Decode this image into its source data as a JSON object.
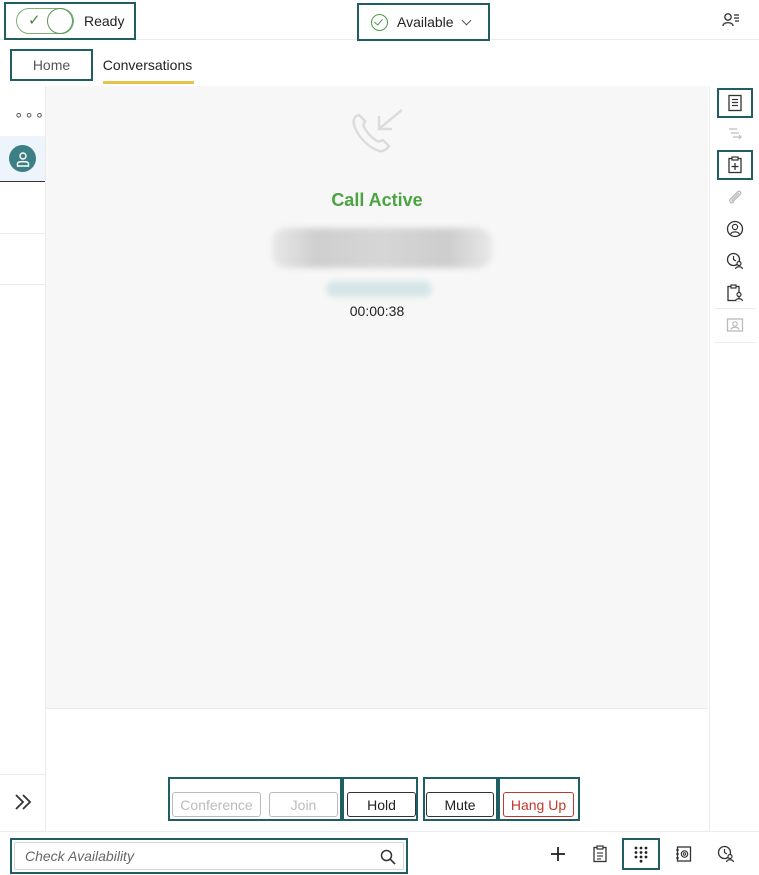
{
  "header": {
    "ready_label": "Ready",
    "availability_label": "Available"
  },
  "tabs": [
    {
      "label": "Home"
    },
    {
      "label": "Conversations"
    }
  ],
  "call": {
    "status": "Call Active",
    "timer": "00:00:38"
  },
  "controls": {
    "conference": "Conference",
    "join": "Join",
    "hold": "Hold",
    "mute": "Mute",
    "hang_up": "Hang Up"
  },
  "search": {
    "placeholder": "Check Availability"
  },
  "colors": {
    "accent": "#1f5f63",
    "active_green": "#4aa441",
    "tab_underline": "#e8c24a",
    "hang_up_red": "#c0392b",
    "avatar_teal": "#3c7f85"
  },
  "icons": {
    "right_rail": [
      "notes-icon",
      "list-icon",
      "add-task-icon",
      "attachment-icon",
      "contact-icon",
      "agent-status-icon",
      "clipboard-user-icon",
      "profile-card-icon"
    ],
    "bottom_bar": [
      "plus-icon",
      "clipboard-icon",
      "dialpad-icon",
      "address-book-icon",
      "agent-availability-icon"
    ]
  }
}
